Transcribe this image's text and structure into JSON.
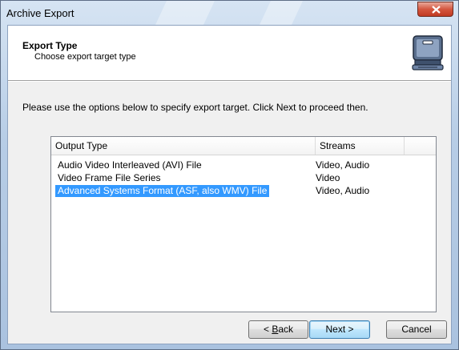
{
  "window": {
    "title": "Archive Export"
  },
  "header": {
    "title": "Export Type",
    "subtitle": "Choose export target type",
    "icon": "briefcase-icon"
  },
  "instruction": "Please use the options below to specify export target. Click Next to proceed then.",
  "list": {
    "columns": [
      "Output Type",
      "Streams"
    ],
    "rows": [
      {
        "type": "Audio Video Interleaved (AVI) File",
        "streams": "Video, Audio",
        "selected": false
      },
      {
        "type": "Video Frame File Series",
        "streams": "Video",
        "selected": false
      },
      {
        "type": "Advanced Systems Format (ASF, also WMV) File",
        "streams": "Video, Audio",
        "selected": true
      }
    ]
  },
  "buttons": {
    "back_prefix": "< ",
    "back_mnemonic": "B",
    "back_rest": "ack",
    "next": "Next >",
    "cancel": "Cancel"
  },
  "colors": {
    "selection": "#3399ff",
    "close_button": "#c13a22"
  }
}
